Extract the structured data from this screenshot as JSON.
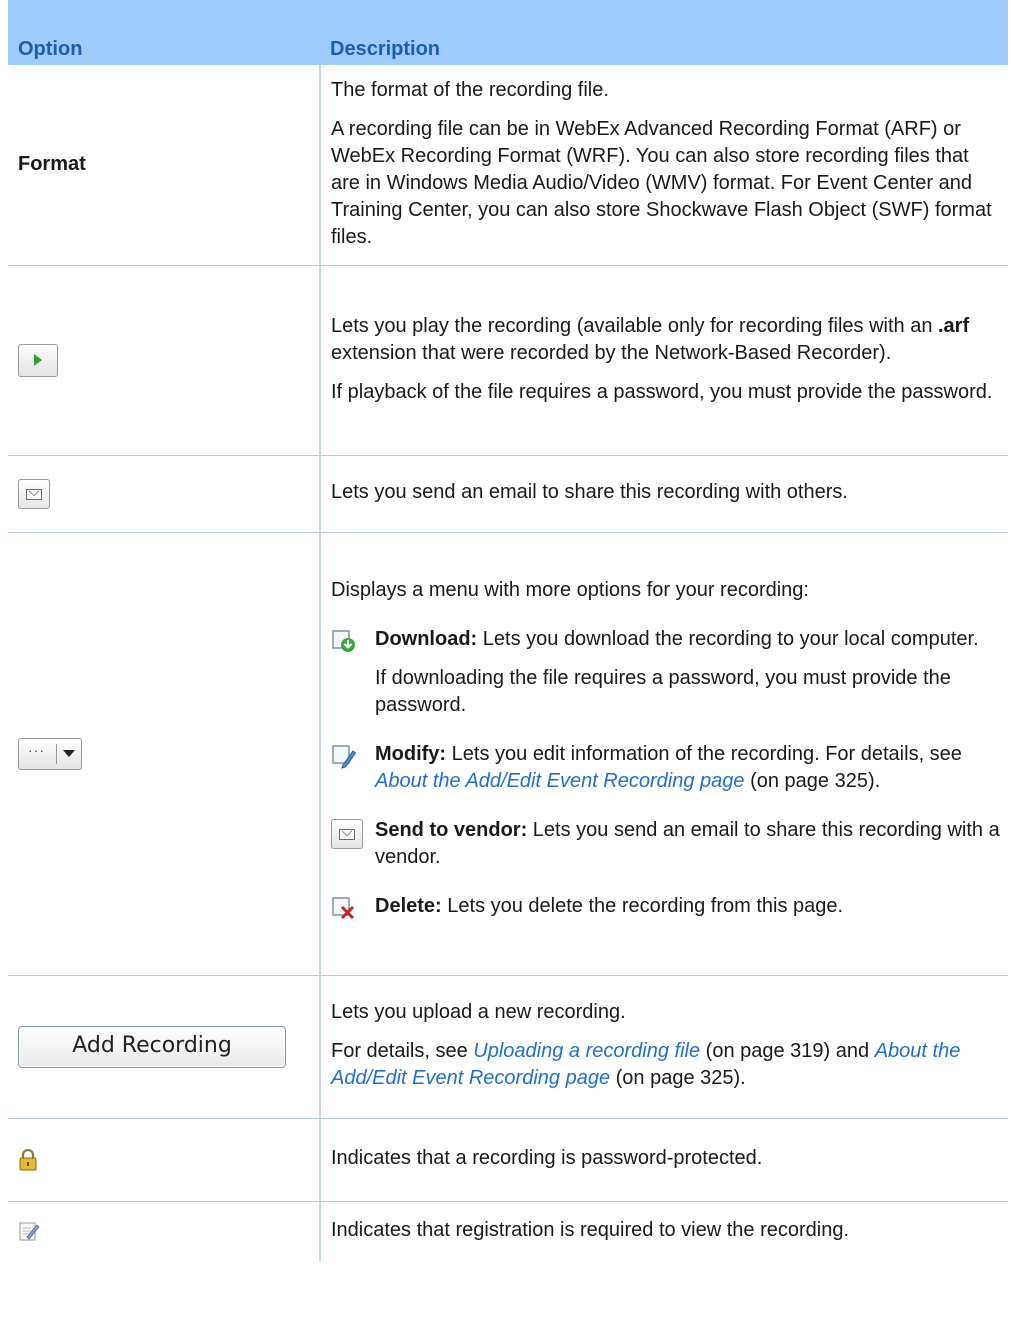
{
  "header": {
    "option": "Option",
    "description": "Description"
  },
  "rows": {
    "format": {
      "option": "Format",
      "p1": "The format of the recording file.",
      "p2": "A recording file can be in WebEx Advanced Recording Format (ARF) or WebEx Recording Format (WRF). You can also store recording files that are in Windows Media Audio/Video (WMV) format. For Event Center and Training Center, you can also store Shockwave Flash Object (SWF) format files."
    },
    "play": {
      "icon": "play-icon",
      "p1_a": "Lets you play the recording (available only for recording files with an ",
      "p1_b": ".arf",
      "p1_c": " extension that were recorded by the Network-Based Recorder).",
      "p2": "If playback of the file requires a password, you must provide the password."
    },
    "email": {
      "icon": "envelope-icon",
      "p1": "Lets you send an email to share this recording with others."
    },
    "more": {
      "icon": "more-options-icon",
      "intro": "Displays a menu with more options for your recording:",
      "download_label": "Download:",
      "download_text": " Lets you download the recording to your local computer.",
      "download_note": "If downloading the file requires a password, you must provide the password.",
      "modify_label": "Modify:",
      "modify_text_a": " Lets you edit information of the recording. For details, see ",
      "modify_link": "About the Add/Edit Event Recording page",
      "modify_text_b": " (on page 325).",
      "vendor_label": "Send to vendor:",
      "vendor_text": " Lets you send an email to share this recording with a vendor.",
      "delete_label": "Delete:",
      "delete_text": " Lets you delete the recording from this page."
    },
    "add": {
      "button_label": "Add Recording",
      "p1": "Lets you upload a new recording.",
      "p2_a": "For details, see ",
      "p2_link1": "Uploading a recording file",
      "p2_b": " (on page 319) and ",
      "p2_link2": "About the Add/Edit Event Recording page",
      "p2_c": " (on page 325)."
    },
    "lock": {
      "icon": "lock-icon",
      "p1": "Indicates that a recording is password-protected."
    },
    "registration": {
      "icon": "registration-icon",
      "p1": "Indicates that registration is required to view the recording."
    }
  },
  "colors": {
    "header_bg": "#9fcbff",
    "header_text": "#1a5fb0",
    "link": "#1f6fd0"
  }
}
